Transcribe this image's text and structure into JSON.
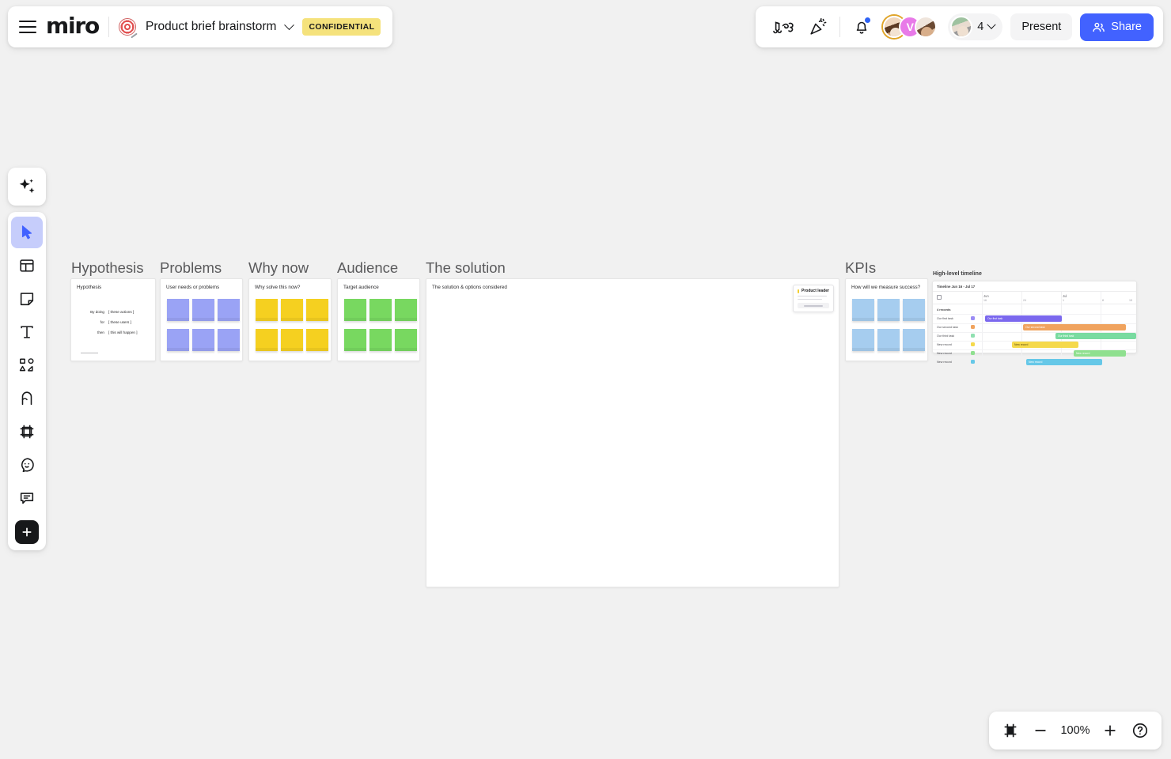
{
  "header": {
    "menu_icon": "hamburger-icon",
    "logo": "miro",
    "board_icon": "dartboard-emoji",
    "board_title": "Product brief brainstorm",
    "title_chevron": "chevron-down-icon",
    "badge": "CONFIDENTIAL",
    "music_icon": "music-notes-icon",
    "celebrate_icon": "party-popper-icon",
    "notifications_icon": "bell-icon",
    "avatars": [
      {
        "name": "avatar-1",
        "initial": ""
      },
      {
        "name": "avatar-2",
        "initial": "V"
      },
      {
        "name": "avatar-3",
        "initial": ""
      }
    ],
    "collaborator_count": "4",
    "count_chevron": "chevron-down-icon",
    "present_label": "Present",
    "share_label": "Share",
    "share_icon": "people-icon",
    "share_color": "#4262ff",
    "badge_color": "#f5e27c"
  },
  "toolbar": {
    "items": [
      {
        "name": "ai-sparkle-tool",
        "label": "AI"
      },
      {
        "name": "select-tool",
        "label": "Select"
      },
      {
        "name": "templates-tool",
        "label": "Templates"
      },
      {
        "name": "sticky-note-tool",
        "label": "Sticky note"
      },
      {
        "name": "text-tool",
        "label": "Text"
      },
      {
        "name": "shapes-tool",
        "label": "Shapes and connectors"
      },
      {
        "name": "pen-tool",
        "label": "Pen"
      },
      {
        "name": "frame-tool",
        "label": "Frame"
      },
      {
        "name": "sticker-tool",
        "label": "Sticker"
      },
      {
        "name": "comment-tool",
        "label": "Comment"
      },
      {
        "name": "more-apps-tool",
        "label": "More apps"
      }
    ],
    "active": "select-tool",
    "active_color": "#c6cdfb"
  },
  "canvas": {
    "frames": [
      {
        "name": "frame-hypothesis",
        "title": "Hypothesis",
        "label": "Hypothesis",
        "type": "hypothesis",
        "rows": [
          {
            "lead": "By doing",
            "value": "[ these actions ]"
          },
          {
            "lead": "for",
            "value": "[ these users ]"
          },
          {
            "lead": "then",
            "value": "[ this will happen ]"
          }
        ]
      },
      {
        "name": "frame-problems",
        "title": "Problems",
        "label": "User needs or problems",
        "type": "notes",
        "note_color": "#9aa3f5",
        "note_count": 6
      },
      {
        "name": "frame-why-now",
        "title": "Why now",
        "label": "Why solve this now?",
        "type": "notes",
        "note_color": "#f5d020",
        "note_count": 6
      },
      {
        "name": "frame-audience",
        "title": "Audience",
        "label": "Target audience",
        "type": "notes",
        "note_color": "#78d860",
        "note_count": 6
      },
      {
        "name": "frame-the-solution",
        "title": "The solution",
        "label": "The solution & options considered",
        "type": "solution"
      },
      {
        "name": "frame-kpis",
        "title": "KPIs",
        "label": "How will we measure success?",
        "type": "notes",
        "note_color": "#a6cdef",
        "note_count": 6
      }
    ],
    "product_leader_card": {
      "name": "product-leader-card",
      "title": "Product leader",
      "icon": "yellow-square-icon"
    },
    "timeline": {
      "name": "high-level-timeline",
      "title": "High-level timeline",
      "subtitle": "Timeline Jun 16 - Jul 17",
      "months": [
        {
          "label": "Jun",
          "day": "16"
        },
        {
          "label": "",
          "day": "24"
        },
        {
          "label": "Jul",
          "day": "1"
        },
        {
          "label": "",
          "day": "8"
        },
        {
          "label": "",
          "day": "15"
        }
      ],
      "group_label": "4 records",
      "rows": [
        {
          "task": "Our first task",
          "color": "#7b68ee",
          "start": 0.14,
          "end": 0.66
        },
        {
          "task": "Our second task",
          "color": "#f0a35e",
          "start": 0.35,
          "end": 0.93
        },
        {
          "task": "Our third task",
          "color": "#79dba0",
          "start": 0.52,
          "end": 1.0
        },
        {
          "task": "New record",
          "color": "#f5d94b",
          "start": 0.31,
          "end": 0.74
        },
        {
          "task": "New record",
          "color": "#8fe08f",
          "start": 0.76,
          "end": 0.97
        },
        {
          "task": "New record",
          "color": "#66c8e8",
          "start": 0.49,
          "end": 0.9
        }
      ]
    }
  },
  "zoombar": {
    "frames_icon": "frames-panel-icon",
    "zoom_out_icon": "minus-icon",
    "zoom_level": "100%",
    "zoom_in_icon": "plus-icon",
    "help_icon": "question-mark-icon"
  }
}
